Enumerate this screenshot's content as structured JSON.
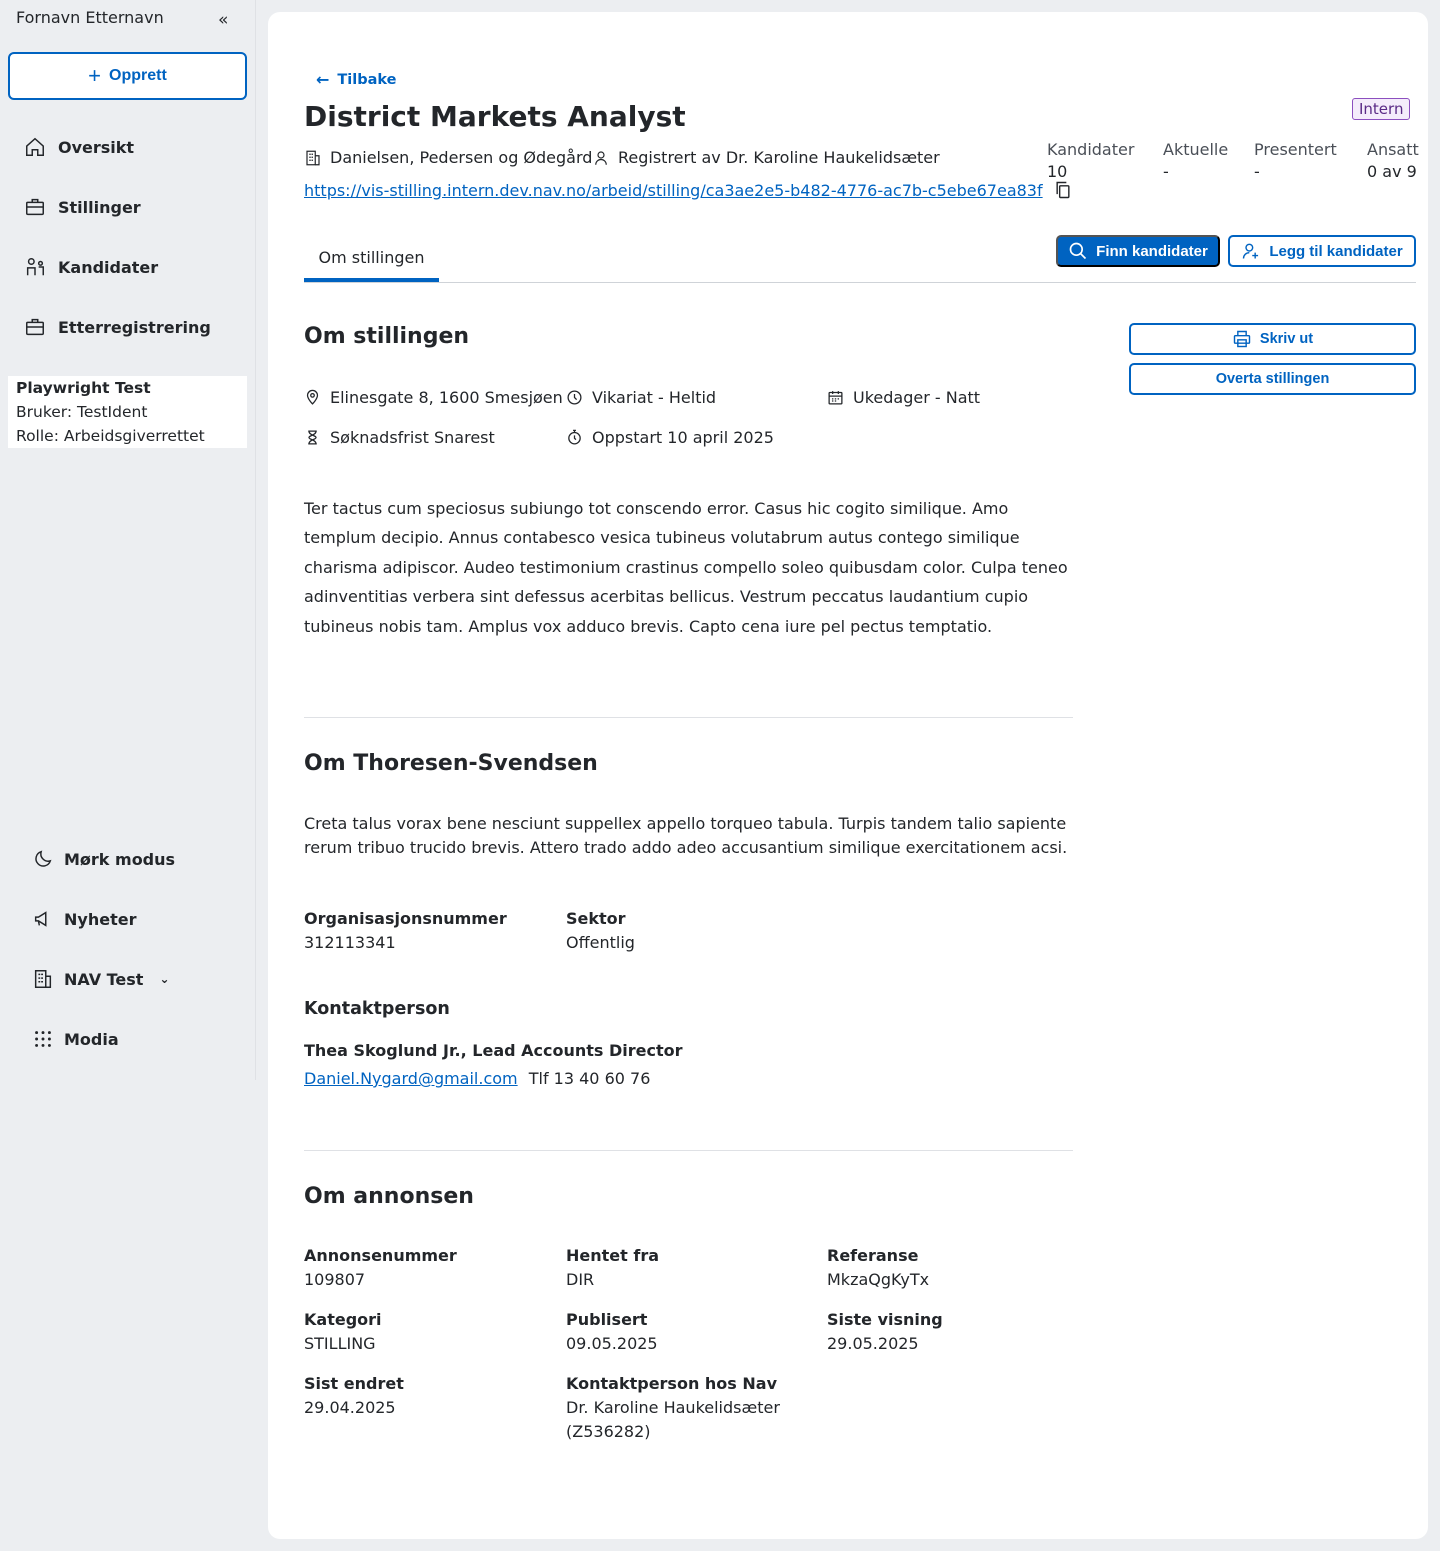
{
  "sidebar": {
    "user_name": "Fornavn Etternavn",
    "create_label": "Opprett",
    "items": [
      {
        "label": "Oversikt"
      },
      {
        "label": "Stillinger"
      },
      {
        "label": "Kandidater"
      },
      {
        "label": "Etterregistrering"
      }
    ],
    "test_info": {
      "title": "Playwright Test",
      "user": "Bruker: TestIdent",
      "role": "Rolle: Arbeidsgiverrettet"
    },
    "bottom_items": [
      {
        "label": "Mørk modus"
      },
      {
        "label": "Nyheter"
      },
      {
        "label": "NAV Test"
      },
      {
        "label": "Modia"
      }
    ]
  },
  "header": {
    "back_label": "Tilbake",
    "title": "District Markets Analyst",
    "badge": "Intern",
    "employer": "Danielsen, Pedersen og Ødegård",
    "registered_by": "Registrert av Dr. Karoline Haukelidsæter",
    "url": "https://vis-stilling.intern.dev.nav.no/arbeid/stilling/ca3ae2e5-b482-4776-ac7b-c5ebe67ea83f",
    "stats": [
      {
        "label": "Kandidater",
        "value": "10"
      },
      {
        "label": "Aktuelle",
        "value": "-"
      },
      {
        "label": "Presentert",
        "value": "-"
      },
      {
        "label": "Ansatt",
        "value": "0 av 9"
      }
    ]
  },
  "tabs": [
    {
      "label": "Om stillingen"
    }
  ],
  "actions": {
    "find_candidates": "Finn kandidater",
    "add_candidates": "Legg til kandidater",
    "print": "Skriv ut",
    "take_over": "Overta stillingen"
  },
  "about_position": {
    "heading": "Om stillingen",
    "location": "Elinesgate 8, 1600 Smesjøen",
    "employment": "Vikariat - Heltid",
    "workdays": "Ukedager - Natt",
    "deadline": "Søknadsfrist Snarest",
    "start": "Oppstart 10 april 2025",
    "description": "Ter tactus cum speciosus subiungo tot conscendo error. Casus hic cogito similique. Amo templum decipio. Annus contabesco vesica tubineus volutabrum autus contego similique charisma adipiscor. Audeo testimonium crastinus compello soleo quibusdam color. Culpa teneo adinventitias verbera sint defessus acerbitas bellicus. Vestrum peccatus laudantium cupio tubineus nobis tam. Amplus vox adduco brevis. Capto cena iure pel pectus temptatio."
  },
  "about_employer": {
    "heading": "Om Thoresen-Svendsen",
    "description": "Creta talus vorax bene nesciunt suppellex appello torqueo tabula. Turpis tandem talio sapiente rerum tribuo trucido brevis. Attero trado addo adeo accusantium similique exercitationem acsi.",
    "org_label": "Organisasjonsnummer",
    "org_value": "312113341",
    "sector_label": "Sektor",
    "sector_value": "Offentlig",
    "contact_heading": "Kontaktperson",
    "contact_name": "Thea Skoglund Jr., Lead Accounts Director",
    "contact_email": "Daniel.Nygard@gmail.com",
    "contact_phone": "Tlf 13 40 60 76"
  },
  "about_ad": {
    "heading": "Om annonsen",
    "fields": [
      {
        "label": "Annonsenummer",
        "value": "109807"
      },
      {
        "label": "Hentet fra",
        "value": "DIR"
      },
      {
        "label": "Referanse",
        "value": "MkzaQgKyTx"
      },
      {
        "label": "Kategori",
        "value": "STILLING"
      },
      {
        "label": "Publisert",
        "value": "09.05.2025"
      },
      {
        "label": "Siste visning",
        "value": "29.05.2025"
      },
      {
        "label": "Sist endret",
        "value": "29.04.2025"
      },
      {
        "label": "Kontaktperson hos Nav",
        "value": "Dr. Karoline Haukelidsæter (Z536282)"
      }
    ]
  },
  "colors": {
    "accent": "#0063c1",
    "background": "#eceef1",
    "badge": "#8c4fbf"
  }
}
